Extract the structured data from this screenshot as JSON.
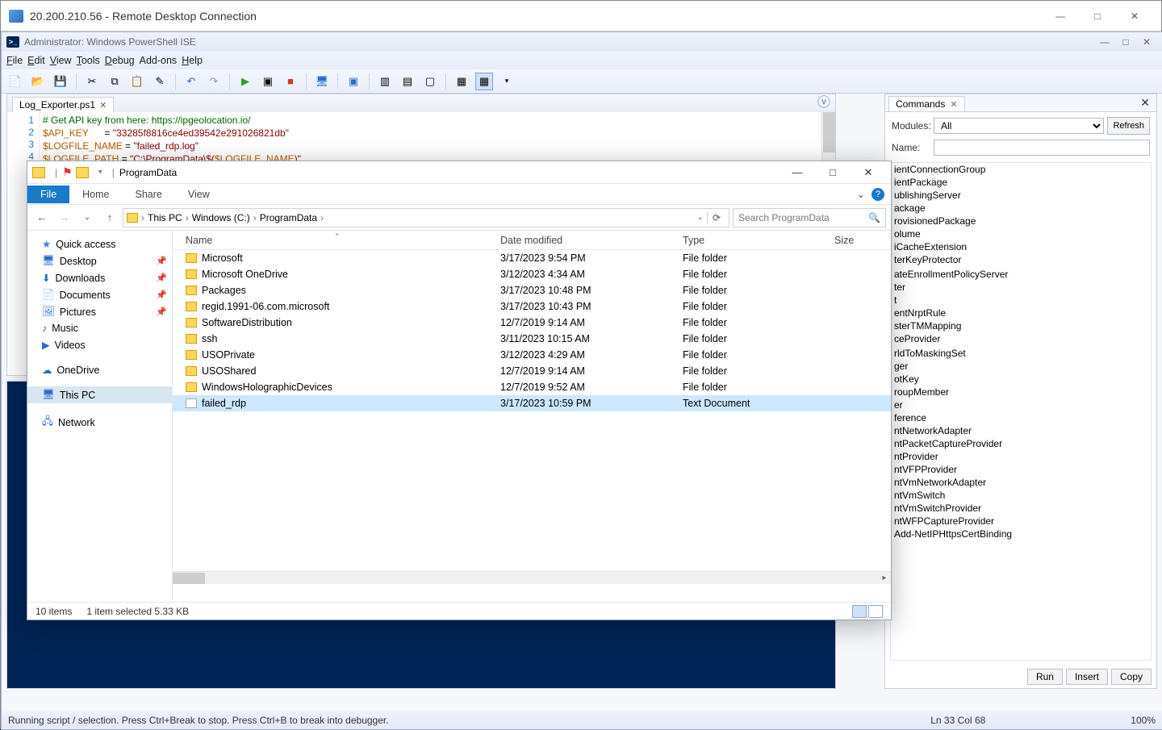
{
  "rdp": {
    "title": "20.200.210.56 - Remote Desktop Connection"
  },
  "ise": {
    "title": "Administrator: Windows PowerShell ISE",
    "menu": [
      "File",
      "Edit",
      "View",
      "Tools",
      "Debug",
      "Add-ons",
      "Help"
    ],
    "tab": "Log_Exporter.ps1",
    "code_lines": [
      "1",
      "2",
      "3",
      "4"
    ],
    "code": {
      "l1a": "# Get API key from here: https://ipgeolocation.io/",
      "l2a": "$API_KEY",
      "l2b": "      = ",
      "l2c": "\"33285f8816ce4ed39542e291026821db\"",
      "l3a": "$LOGFILE_NAME",
      "l3b": " = ",
      "l3c": "\"failed_rdp.log\"",
      "l4a": "$LOGFILE_PATH",
      "l4b": " = ",
      "l4c": "\"C:\\ProgramData\\$(",
      "l4d": "$LOGFILE_NAME",
      "l4e": ")\""
    },
    "status_left": "Running script / selection.  Press Ctrl+Break to stop.  Press Ctrl+B to break into debugger.",
    "status_pos": "Ln 33  Col 68",
    "status_zoom": "100%"
  },
  "cmd": {
    "title": "Commands",
    "modules_label": "Modules:",
    "modules_value": "All",
    "name_label": "Name:",
    "refresh": "Refresh",
    "items": [
      "ientConnectionGroup",
      "ientPackage",
      "ublishingServer",
      "ackage",
      "rovisionedPackage",
      "olume",
      "iCacheExtension",
      "terKeyProtector",
      "",
      "ateEnrollmentPolicyServer",
      "ter",
      "t",
      "entNrptRule",
      "sterTMMapping",
      "ceProvider",
      "",
      "rldToMaskingSet",
      "ger",
      "otKey",
      "roupMember",
      "er",
      "ference",
      "ntNetworkAdapter",
      "ntPacketCaptureProvider",
      "ntProvider",
      "ntVFPProvider",
      "ntVmNetworkAdapter",
      "ntVmSwitch",
      "ntVmSwitchProvider",
      "ntWFPCaptureProvider",
      "Add-NetIPHttpsCertBinding"
    ],
    "run": "Run",
    "insert": "Insert",
    "copy": "Copy"
  },
  "explorer": {
    "title": "ProgramData",
    "tabs": {
      "file": "File",
      "home": "Home",
      "share": "Share",
      "view": "View"
    },
    "crumbs": [
      "This PC",
      "Windows (C:)",
      "ProgramData"
    ],
    "search_placeholder": "Search ProgramData",
    "nav": {
      "quick": "Quick access",
      "desktop": "Desktop",
      "downloads": "Downloads",
      "documents": "Documents",
      "pictures": "Pictures",
      "music": "Music",
      "videos": "Videos",
      "onedrive": "OneDrive",
      "thispc": "This PC",
      "network": "Network"
    },
    "cols": {
      "name": "Name",
      "date": "Date modified",
      "type": "Type",
      "size": "Size"
    },
    "rows": [
      {
        "name": "Microsoft",
        "date": "3/17/2023 9:54 PM",
        "type": "File folder",
        "size": "",
        "k": "folder"
      },
      {
        "name": "Microsoft OneDrive",
        "date": "3/12/2023 4:34 AM",
        "type": "File folder",
        "size": "",
        "k": "folder"
      },
      {
        "name": "Packages",
        "date": "3/17/2023 10:48 PM",
        "type": "File folder",
        "size": "",
        "k": "folder"
      },
      {
        "name": "regid.1991-06.com.microsoft",
        "date": "3/17/2023 10:43 PM",
        "type": "File folder",
        "size": "",
        "k": "folder"
      },
      {
        "name": "SoftwareDistribution",
        "date": "12/7/2019 9:14 AM",
        "type": "File folder",
        "size": "",
        "k": "folder"
      },
      {
        "name": "ssh",
        "date": "3/11/2023 10:15 AM",
        "type": "File folder",
        "size": "",
        "k": "folder"
      },
      {
        "name": "USOPrivate",
        "date": "3/12/2023 4:29 AM",
        "type": "File folder",
        "size": "",
        "k": "folder"
      },
      {
        "name": "USOShared",
        "date": "12/7/2019 9:14 AM",
        "type": "File folder",
        "size": "",
        "k": "folder"
      },
      {
        "name": "WindowsHolographicDevices",
        "date": "12/7/2019 9:52 AM",
        "type": "File folder",
        "size": "",
        "k": "folder"
      },
      {
        "name": "failed_rdp",
        "date": "3/17/2023 10:59 PM",
        "type": "Text Document",
        "size": "",
        "k": "doc",
        "sel": true
      }
    ],
    "status": {
      "count": "10 items",
      "sel": "1 item selected  5.33 KB"
    }
  }
}
